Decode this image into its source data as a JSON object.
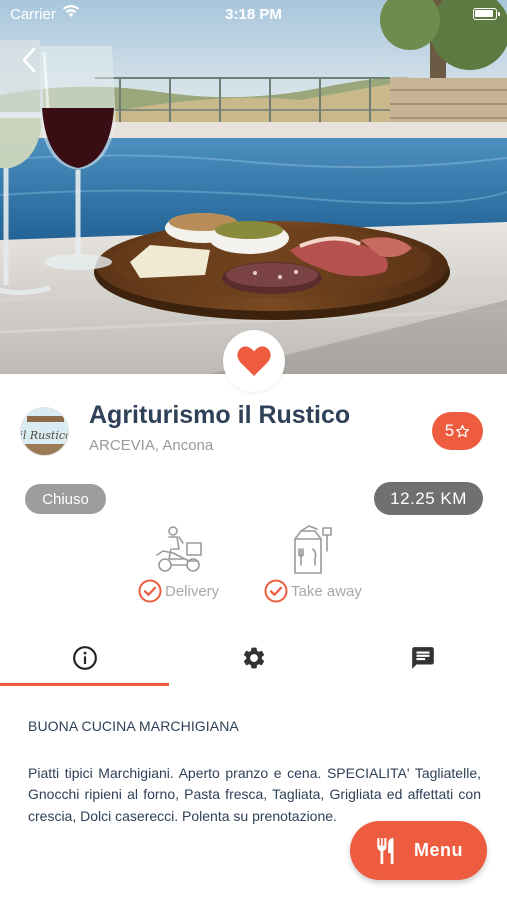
{
  "status_bar": {
    "carrier": "Carrier",
    "time": "3:18 PM",
    "wifi_icon": "wifi-icon",
    "battery_icon": "battery-icon"
  },
  "hero": {
    "image": "hero-photo",
    "back_icon": "chevron-left-icon",
    "favorite_icon": "heart-icon",
    "favorite_active": true
  },
  "restaurant": {
    "name": "Agriturismo il Rustico",
    "location": "ARCEVIA, Ancona",
    "logo_text": "il Rustico",
    "rating": "5",
    "rating_icon": "star-outline-icon",
    "status": "Chiuso",
    "distance": "12.25 KM"
  },
  "services": [
    {
      "label": "Delivery",
      "icon": "delivery-scooter-icon",
      "check_icon": "check-circle-icon"
    },
    {
      "label": "Take away",
      "icon": "takeaway-bag-icon",
      "check_icon": "check-circle-icon"
    }
  ],
  "tabs": [
    {
      "icon": "info-icon",
      "active": true
    },
    {
      "icon": "gear-icon",
      "active": false
    },
    {
      "icon": "chat-icon",
      "active": false
    }
  ],
  "description": {
    "heading": "BUONA CUCINA MARCHIGIANA",
    "body": "Piatti tipici Marchigiani. Aperto pranzo e cena. SPECIALITA' Tagliatelle, Gnocchi ripieni al forno, Pasta fresca, Tagliata, Grigliata ed affettati con crescia, Dolci caserecci. Polenta su prenotazione."
  },
  "menu_button": {
    "label": "Menu",
    "icon": "fork-knife-icon"
  },
  "colors": {
    "accent": "#ee5c3f",
    "title": "#2f4158",
    "status_pill": "#9d9d9d",
    "distance_pill": "#707070",
    "muted_text": "#9a9a9a"
  }
}
